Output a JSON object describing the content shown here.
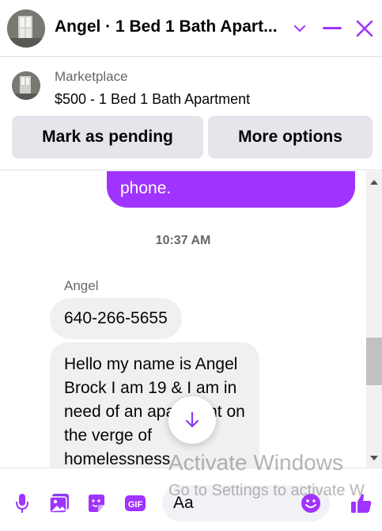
{
  "header": {
    "title": "Angel · 1 Bed 1 Bath Apart...",
    "accent": "#a033ff"
  },
  "marketplace": {
    "label": "Marketplace",
    "listing": "$500 - 1 Bed 1 Bath Apartment",
    "pending_button": "Mark as pending",
    "more_button": "More options"
  },
  "messages": {
    "outgoing_text": "phone.",
    "timestamp": "10:37 AM",
    "sender": "Angel",
    "phone_message": "640-266-5655",
    "long_message": "Hello my name is Angel Brock I am 19 & I am in need of an apartment on the verge of homelessness"
  },
  "composer": {
    "placeholder": "Aa",
    "icons": [
      "microphone-icon",
      "image-icon",
      "sticker-icon",
      "gif-icon",
      "emoji-icon",
      "like-icon"
    ],
    "gif_text": "GIF"
  },
  "watermark": {
    "line1": "Activate Windows",
    "line2": "Go to Settings to activate W"
  }
}
